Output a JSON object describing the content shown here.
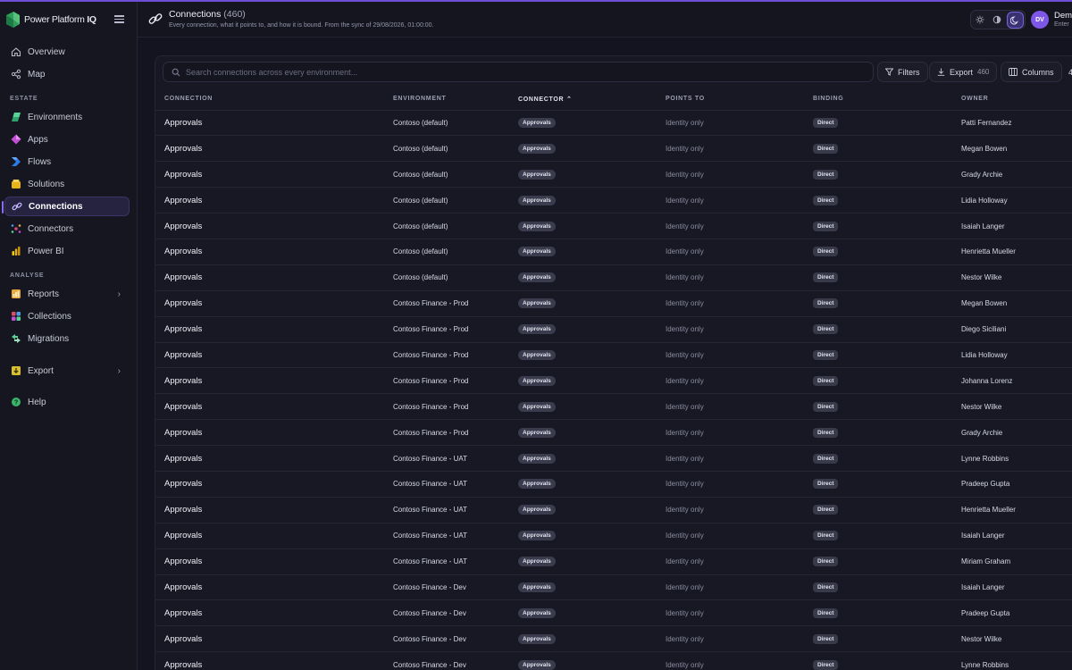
{
  "app": {
    "brand_prefix": "Power Platform ",
    "brand_suffix": "IQ"
  },
  "colors": {
    "accent": "#7e57e6",
    "background": "#13141f"
  },
  "sidebar": {
    "top_items": [
      {
        "label": "Overview",
        "icon": "home-icon"
      },
      {
        "label": "Map",
        "icon": "share-graph-icon"
      }
    ],
    "estate_label": "ESTATE",
    "estate_items": [
      {
        "label": "Environments",
        "icon": "environments-icon"
      },
      {
        "label": "Apps",
        "icon": "apps-icon"
      },
      {
        "label": "Flows",
        "icon": "flows-icon"
      },
      {
        "label": "Solutions",
        "icon": "solutions-icon"
      },
      {
        "label": "Connections",
        "icon": "link-icon",
        "active": true
      },
      {
        "label": "Connectors",
        "icon": "connectors-icon"
      },
      {
        "label": "Power BI",
        "icon": "powerbi-icon"
      }
    ],
    "analyse_label": "ANALYSE",
    "analyse_items": [
      {
        "label": "Reports",
        "icon": "reports-icon",
        "has_children": true
      },
      {
        "label": "Collections",
        "icon": "collections-icon"
      },
      {
        "label": "Migrations",
        "icon": "migrations-icon"
      }
    ],
    "export_label": "Export",
    "help_label": "Help"
  },
  "header": {
    "title": "Connections",
    "count": "(460)",
    "subtitle": "Every connection, what it points to, and how it is bound. From the sync of 29/08/2026, 01:00:00.",
    "user_initials": "DV",
    "user_name": "Dem",
    "user_sub": "Enter"
  },
  "toolbar": {
    "search_placeholder": "Search connections across every environment...",
    "filters_label": "Filters",
    "export_label": "Export",
    "export_count": "460",
    "columns_label": "Columns",
    "cut_label": "4"
  },
  "table": {
    "columns": [
      "CONNECTION",
      "ENVIRONMENT",
      "CONNECTOR",
      "POINTS TO",
      "BINDING",
      "OWNER"
    ],
    "sort_indicator": "⌃",
    "rows": [
      {
        "connection": "Approvals",
        "environment": "Contoso (default)",
        "connector": "Approvals",
        "points_to": "Identity only",
        "binding": "Direct",
        "owner": "Patti Fernandez"
      },
      {
        "connection": "Approvals",
        "environment": "Contoso (default)",
        "connector": "Approvals",
        "points_to": "Identity only",
        "binding": "Direct",
        "owner": "Megan Bowen"
      },
      {
        "connection": "Approvals",
        "environment": "Contoso (default)",
        "connector": "Approvals",
        "points_to": "Identity only",
        "binding": "Direct",
        "owner": "Grady Archie"
      },
      {
        "connection": "Approvals",
        "environment": "Contoso (default)",
        "connector": "Approvals",
        "points_to": "Identity only",
        "binding": "Direct",
        "owner": "Lidia Holloway"
      },
      {
        "connection": "Approvals",
        "environment": "Contoso (default)",
        "connector": "Approvals",
        "points_to": "Identity only",
        "binding": "Direct",
        "owner": "Isaiah Langer"
      },
      {
        "connection": "Approvals",
        "environment": "Contoso (default)",
        "connector": "Approvals",
        "points_to": "Identity only",
        "binding": "Direct",
        "owner": "Henrietta Mueller"
      },
      {
        "connection": "Approvals",
        "environment": "Contoso (default)",
        "connector": "Approvals",
        "points_to": "Identity only",
        "binding": "Direct",
        "owner": "Nestor Wilke"
      },
      {
        "connection": "Approvals",
        "environment": "Contoso Finance - Prod",
        "connector": "Approvals",
        "points_to": "Identity only",
        "binding": "Direct",
        "owner": "Megan Bowen"
      },
      {
        "connection": "Approvals",
        "environment": "Contoso Finance - Prod",
        "connector": "Approvals",
        "points_to": "Identity only",
        "binding": "Direct",
        "owner": "Diego Siciliani"
      },
      {
        "connection": "Approvals",
        "environment": "Contoso Finance - Prod",
        "connector": "Approvals",
        "points_to": "Identity only",
        "binding": "Direct",
        "owner": "Lidia Holloway"
      },
      {
        "connection": "Approvals",
        "environment": "Contoso Finance - Prod",
        "connector": "Approvals",
        "points_to": "Identity only",
        "binding": "Direct",
        "owner": "Johanna Lorenz"
      },
      {
        "connection": "Approvals",
        "environment": "Contoso Finance - Prod",
        "connector": "Approvals",
        "points_to": "Identity only",
        "binding": "Direct",
        "owner": "Nestor Wilke"
      },
      {
        "connection": "Approvals",
        "environment": "Contoso Finance - Prod",
        "connector": "Approvals",
        "points_to": "Identity only",
        "binding": "Direct",
        "owner": "Grady Archie"
      },
      {
        "connection": "Approvals",
        "environment": "Contoso Finance - UAT",
        "connector": "Approvals",
        "points_to": "Identity only",
        "binding": "Direct",
        "owner": "Lynne Robbins"
      },
      {
        "connection": "Approvals",
        "environment": "Contoso Finance - UAT",
        "connector": "Approvals",
        "points_to": "Identity only",
        "binding": "Direct",
        "owner": "Pradeep Gupta"
      },
      {
        "connection": "Approvals",
        "environment": "Contoso Finance - UAT",
        "connector": "Approvals",
        "points_to": "Identity only",
        "binding": "Direct",
        "owner": "Henrietta Mueller"
      },
      {
        "connection": "Approvals",
        "environment": "Contoso Finance - UAT",
        "connector": "Approvals",
        "points_to": "Identity only",
        "binding": "Direct",
        "owner": "Isaiah Langer"
      },
      {
        "connection": "Approvals",
        "environment": "Contoso Finance - UAT",
        "connector": "Approvals",
        "points_to": "Identity only",
        "binding": "Direct",
        "owner": "Miriam Graham"
      },
      {
        "connection": "Approvals",
        "environment": "Contoso Finance - Dev",
        "connector": "Approvals",
        "points_to": "Identity only",
        "binding": "Direct",
        "owner": "Isaiah Langer"
      },
      {
        "connection": "Approvals",
        "environment": "Contoso Finance - Dev",
        "connector": "Approvals",
        "points_to": "Identity only",
        "binding": "Direct",
        "owner": "Pradeep Gupta"
      },
      {
        "connection": "Approvals",
        "environment": "Contoso Finance - Dev",
        "connector": "Approvals",
        "points_to": "Identity only",
        "binding": "Direct",
        "owner": "Nestor Wilke"
      },
      {
        "connection": "Approvals",
        "environment": "Contoso Finance - Dev",
        "connector": "Approvals",
        "points_to": "Identity only",
        "binding": "Direct",
        "owner": "Lynne Robbins"
      }
    ]
  }
}
